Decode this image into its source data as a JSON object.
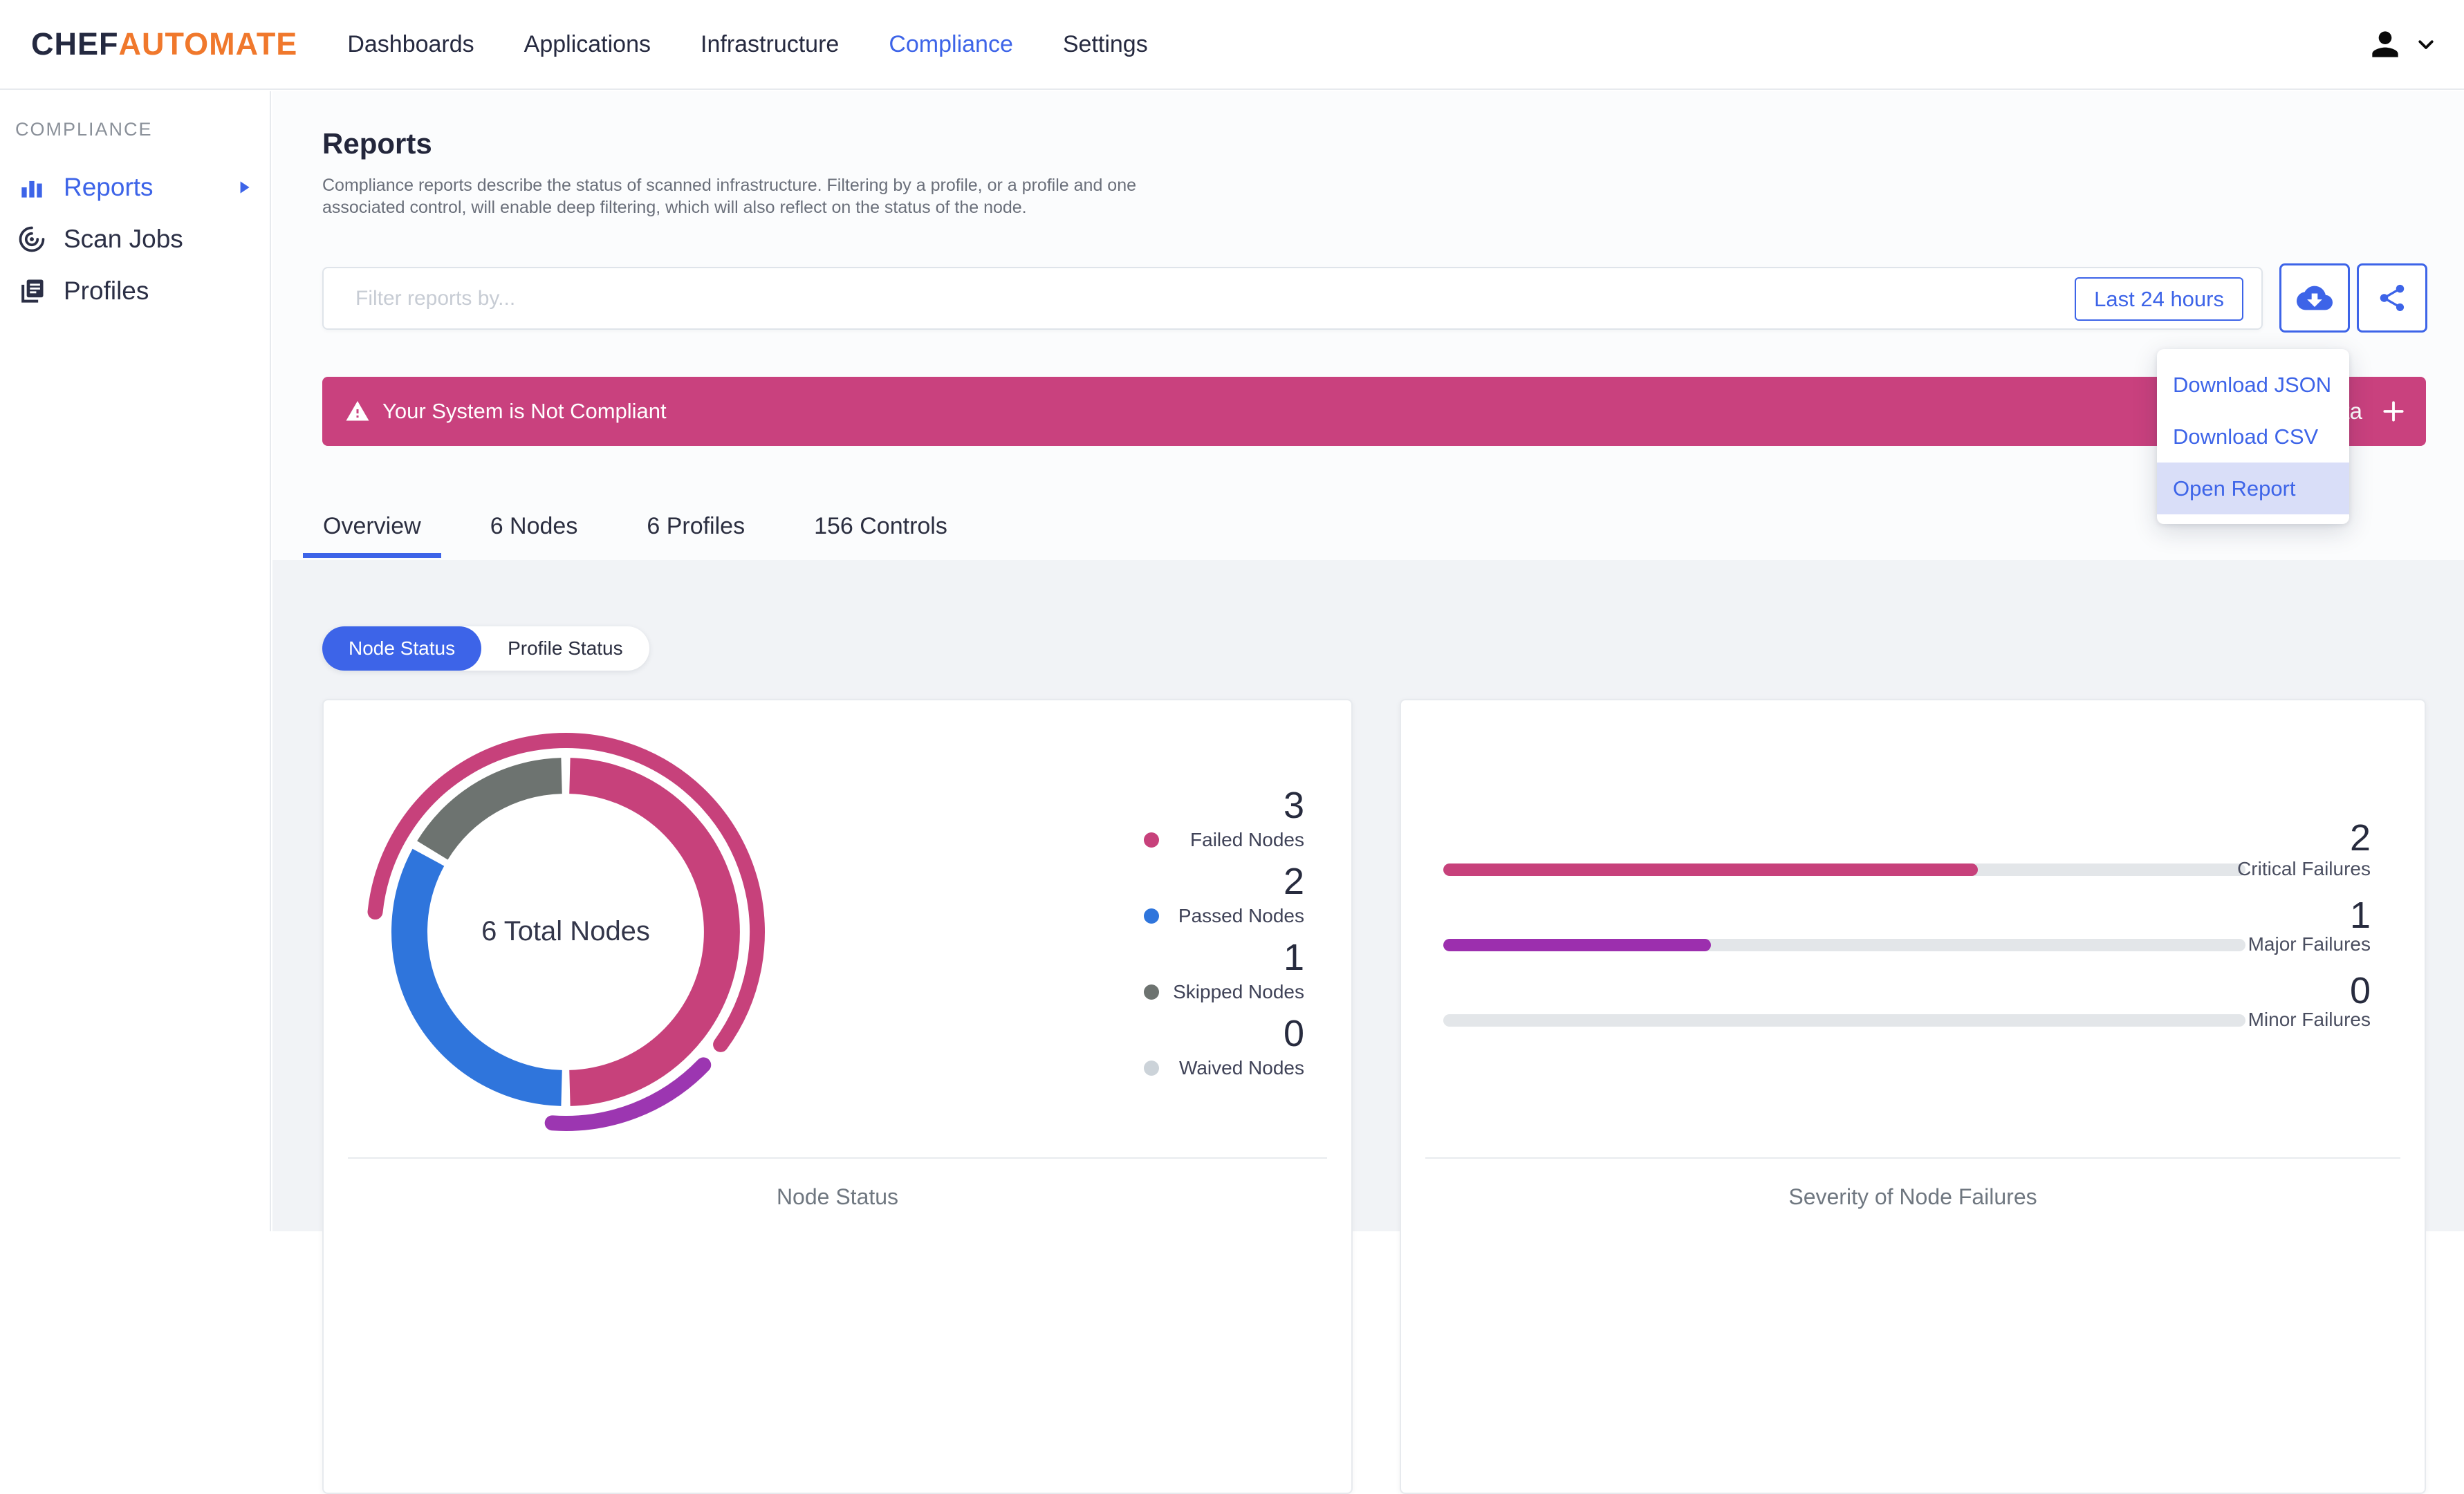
{
  "colors": {
    "primary": "#3d64e8",
    "orange": "#f0782c",
    "navy": "#242940",
    "banner": "#c9417e",
    "track": "#e3e6e9"
  },
  "header": {
    "brand_left": "CHEF",
    "brand_right": "AUTOMATE",
    "nav_items": [
      "Dashboards",
      "Applications",
      "Infrastructure",
      "Compliance",
      "Settings"
    ],
    "active_nav": "Compliance"
  },
  "sidebar": {
    "section_label": "COMPLIANCE",
    "items": [
      "Reports",
      "Scan Jobs",
      "Profiles"
    ],
    "active_item": "Reports"
  },
  "page": {
    "title": "Reports",
    "description": "Compliance reports describe the status of scanned infrastructure. Filtering by a profile, or a profile and one associated control, will enable deep filtering, which will also reflect on the status of the node."
  },
  "filter": {
    "placeholder": "Filter reports by...",
    "time_range_button": "Last 24 hours"
  },
  "download_menu": {
    "items": [
      "Download JSON",
      "Download CSV",
      "Open Report"
    ],
    "highlighted": "Open Report"
  },
  "banner": {
    "text": "Your System is Not Compliant",
    "right_fragment": "ta"
  },
  "tabs": [
    "Overview",
    "6 Nodes",
    "6 Profiles",
    "156 Controls"
  ],
  "active_tab": "Overview",
  "status_toggle": {
    "options": [
      "Node Status",
      "Profile Status"
    ],
    "active": "Node Status"
  },
  "chart_data": [
    {
      "type": "pie",
      "donut": true,
      "title": "Node Status",
      "center_label": "6 Total Nodes",
      "total": 6,
      "segments": [
        {
          "label": "Failed Nodes",
          "value": 3,
          "color": "#c7417b"
        },
        {
          "label": "Passed Nodes",
          "value": 2,
          "color": "#2f75dc"
        },
        {
          "label": "Skipped Nodes",
          "value": 1,
          "color": "#6d7370"
        },
        {
          "label": "Waived Nodes",
          "value": 0,
          "color": "#ccd3d9"
        }
      ],
      "outer_arcs": [
        {
          "label": "Critical",
          "color": "#c7417b",
          "start_deg": -84,
          "end_deg": 126
        },
        {
          "label": "Major",
          "color": "#9c36b1",
          "start_deg": 134,
          "end_deg": 184
        }
      ],
      "legend_position": "right"
    },
    {
      "type": "bar",
      "orientation": "horizontal",
      "title": "Severity of Node Failures",
      "categories": [
        "Critical Failures",
        "Major Failures",
        "Minor Failures"
      ],
      "values": [
        2,
        1,
        0
      ],
      "max": 3,
      "colors": [
        "#c7417b",
        "#9c2fae",
        "#e3e6e9"
      ],
      "track_color": "#e3e6e9"
    }
  ]
}
